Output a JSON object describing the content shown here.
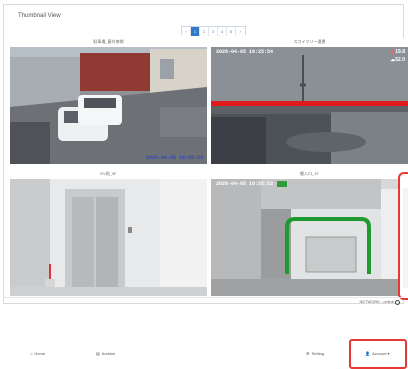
{
  "page": {
    "title": "Thumbnail View"
  },
  "pagination": [
    "‹",
    "1",
    "2",
    "3",
    "4",
    "5",
    "›"
  ],
  "cameras": [
    {
      "name": "駐車場_屋外南側",
      "timestamp": "2026-04-05 16:25:53"
    },
    {
      "name": "スカイツリー遠景",
      "timestamp": "2026-04-05 16:25:54",
      "temp": "19.8",
      "humidity": "52.0"
    },
    {
      "name": "EV前_3F",
      "timestamp": ""
    },
    {
      "name": "搬入口_1F",
      "timestamp": "2026-04-05 16:25:53"
    }
  ],
  "status": {
    "text": "NETWORK : online"
  },
  "nav": {
    "home": "Home",
    "archive": "Archive",
    "setting": "Setting",
    "account": "Account ▾"
  },
  "colors": {
    "accent": "#3478c8",
    "highlight": "#e53935"
  }
}
